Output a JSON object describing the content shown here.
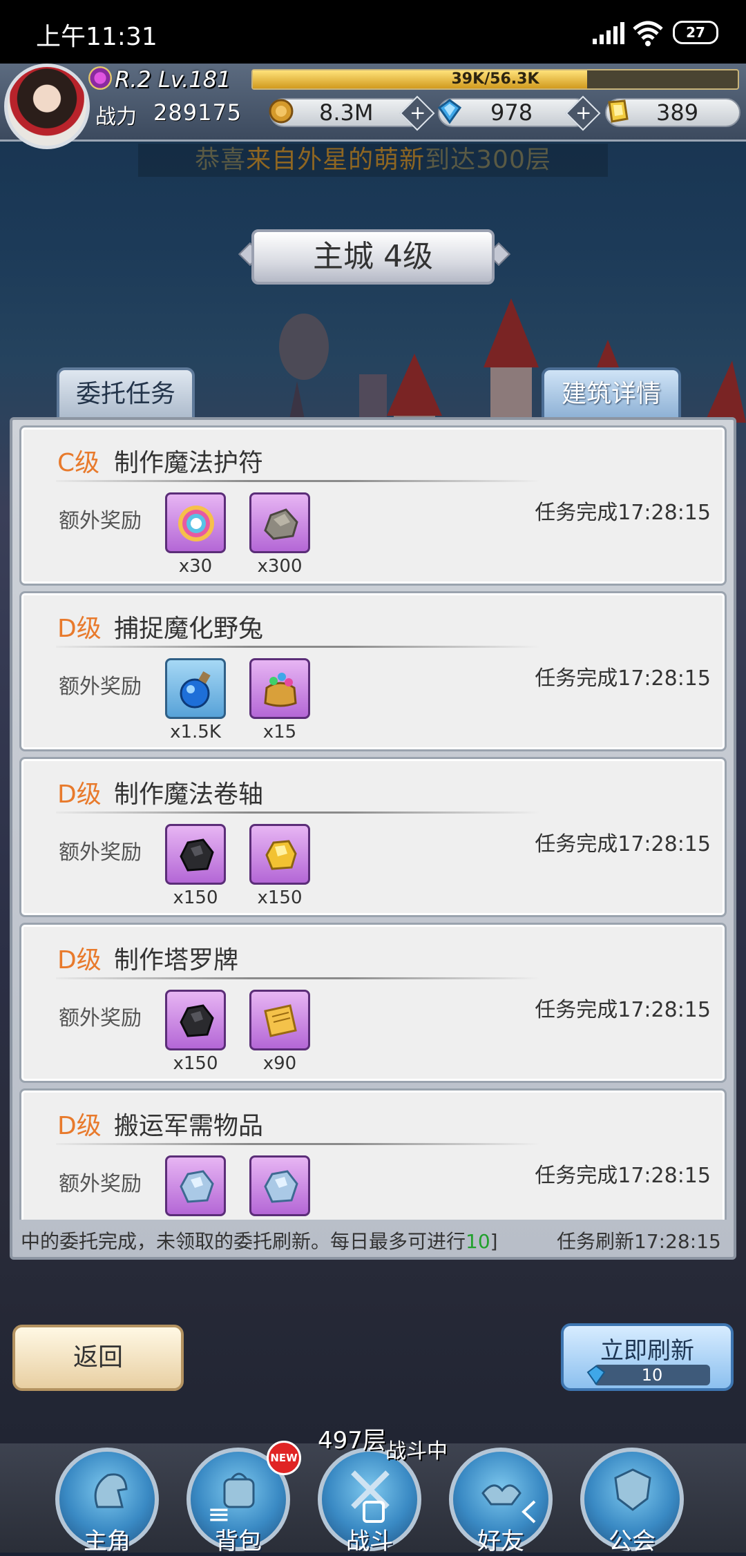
{
  "status_bar": {
    "time": "上午11:31",
    "battery": "27"
  },
  "player": {
    "rank_level": "R.2 Lv.181",
    "exp_text": "39K/56.3K",
    "exp_fraction": 0.69,
    "power_label": "战力",
    "power_value": "289175"
  },
  "resources": {
    "gold": "8.3M",
    "diamond": "978",
    "gem": "389",
    "plus": "+"
  },
  "ticker": {
    "prefix": "恭喜",
    "highlight": "来自外星的萌新",
    "suffix": "到达300层"
  },
  "page_title": "主城 4级",
  "tabs": {
    "commission": "委托任务",
    "building": "建筑详情"
  },
  "reward_label": "额外奖励",
  "tasks": [
    {
      "grade": "C级",
      "name": "制作魔法护符",
      "done": "任务完成17:28:15",
      "rewards": [
        {
          "icon": "rainbow-badge-icon",
          "qty": "x30"
        },
        {
          "icon": "stone-ore-icon",
          "qty": "x300"
        }
      ]
    },
    {
      "grade": "D级",
      "name": "捕捉魔化野兔",
      "done": "任务完成17:28:15",
      "rewards": [
        {
          "icon": "blue-potion-icon",
          "qty": "x1.5K"
        },
        {
          "icon": "gem-bag-icon",
          "qty": "x15"
        }
      ]
    },
    {
      "grade": "D级",
      "name": "制作魔法卷轴",
      "done": "任务完成17:28:15",
      "rewards": [
        {
          "icon": "coal-ore-icon",
          "qty": "x150"
        },
        {
          "icon": "gold-ore-icon",
          "qty": "x150"
        }
      ]
    },
    {
      "grade": "D级",
      "name": "制作塔罗牌",
      "done": "任务完成17:28:15",
      "rewards": [
        {
          "icon": "coal-ore-icon",
          "qty": "x150"
        },
        {
          "icon": "scroll-icon",
          "qty": "x90"
        }
      ]
    },
    {
      "grade": "D级",
      "name": "搬运军需物品",
      "done": "任务完成17:28:15",
      "rewards": [
        {
          "icon": "silver-ore-icon",
          "qty": ""
        },
        {
          "icon": "silver-ore-icon",
          "qty": ""
        }
      ]
    }
  ],
  "footer": {
    "message_a": "中的委托完成，未领取的委托刷新。每日最多可进行",
    "message_num": "10",
    "message_b": "]",
    "refresh_time": "任务刷新17:28:15"
  },
  "buttons": {
    "back": "返回",
    "refresh_now": "立即刷新",
    "refresh_cost": "10"
  },
  "battle": {
    "floor": "497层",
    "status": "战斗中"
  },
  "nav": {
    "items": [
      "主角",
      "背包",
      "战斗",
      "好友",
      "公会"
    ],
    "new_badge": "NEW"
  },
  "colors": {
    "grade_orange": "#e87a2c",
    "highlight_green": "#21a02c",
    "reward_bg_purple": "#c78ae4",
    "nav_blue": "#3a8ac4"
  }
}
